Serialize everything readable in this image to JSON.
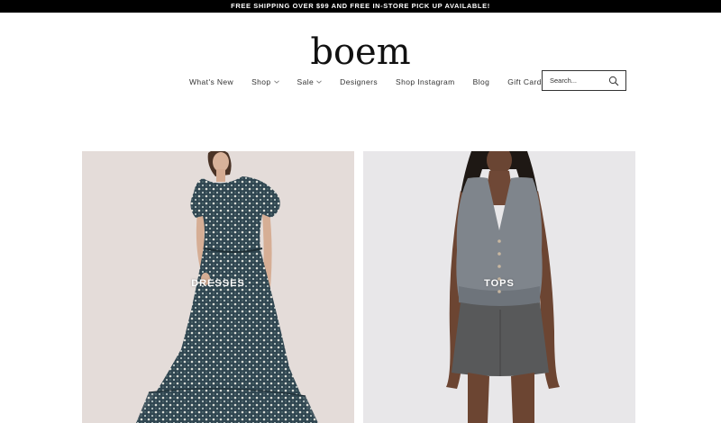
{
  "announcement": "FREE SHIPPING OVER $99 AND FREE IN-STORE PICK UP AVAILABLE!",
  "logo": "boem",
  "nav": {
    "items": [
      {
        "label": "What's New",
        "dropdown": false
      },
      {
        "label": "Shop",
        "dropdown": true
      },
      {
        "label": "Sale",
        "dropdown": true
      },
      {
        "label": "Designers",
        "dropdown": false
      },
      {
        "label": "Shop Instagram",
        "dropdown": false
      },
      {
        "label": "Blog",
        "dropdown": false
      },
      {
        "label": "Gift Card",
        "dropdown": false
      }
    ]
  },
  "search": {
    "placeholder": "Search...",
    "icon": "search-icon"
  },
  "categories": [
    {
      "label": "DRESSES"
    },
    {
      "label": "TOPS"
    }
  ],
  "colors": {
    "announcement_bg": "#000000",
    "announcement_text": "#ffffff",
    "dresses_bg": "#e4dcd9",
    "tops_bg": "#e8e7e9"
  }
}
